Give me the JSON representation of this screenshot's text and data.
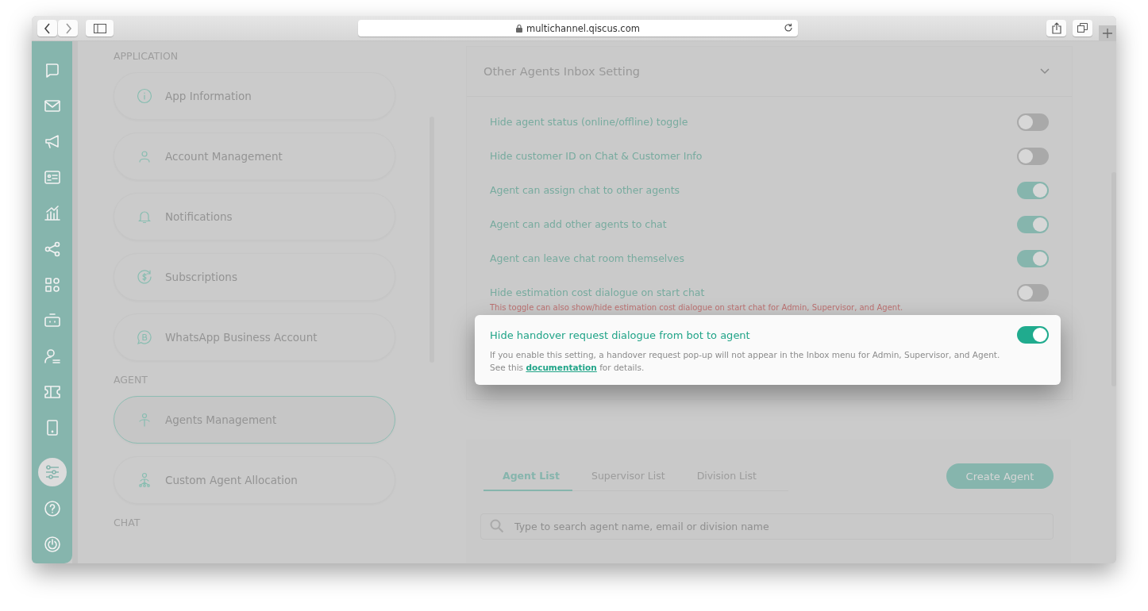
{
  "browser": {
    "url": "multichannel.qiscus.com"
  },
  "rail": [
    {
      "selected": false
    },
    {
      "selected": false
    },
    {
      "selected": false
    },
    {
      "selected": false
    },
    {
      "selected": false
    },
    {
      "selected": false
    },
    {
      "selected": false
    },
    {
      "selected": false
    },
    {
      "selected": false
    },
    {
      "selected": false
    },
    {
      "selected": false
    },
    {
      "selected": true
    },
    {
      "selected": false
    },
    {
      "selected": false
    }
  ],
  "settings_menu": [
    {
      "heading": "APPLICATION",
      "items": [
        {
          "label": "App Information",
          "selected": false
        },
        {
          "label": "Account Management",
          "selected": false
        },
        {
          "label": "Notifications",
          "selected": false
        },
        {
          "label": "Subscriptions",
          "selected": false
        },
        {
          "label": "WhatsApp Business Account",
          "selected": false
        }
      ]
    },
    {
      "heading": "AGENT",
      "items": [
        {
          "label": "Agents Management",
          "selected": true
        },
        {
          "label": "Custom Agent Allocation",
          "selected": false
        }
      ]
    },
    {
      "heading": "CHAT"
    }
  ],
  "inbox_setting": {
    "title": "Other Agents Inbox Setting",
    "expanded": true,
    "toggles": [
      {
        "label": "Hide agent status (online/offline) toggle",
        "on": false
      },
      {
        "label": "Hide customer ID on Chat & Customer Info",
        "on": false
      },
      {
        "label": "Agent can assign chat to other agents",
        "on": true
      },
      {
        "label": "Agent can add other agents to chat",
        "on": true
      },
      {
        "label": "Agent can leave chat room themselves",
        "on": true
      },
      {
        "label": "Hide estimation cost dialogue on start chat",
        "on": false,
        "note": "This toggle can also show/hide estimation cost dialogue on start chat for Admin, Supervisor, and Agent."
      }
    ],
    "highlighted": {
      "label": "Hide handover request dialogue from bot to agent",
      "on": true,
      "description": "If you enable this setting, a handover request pop-up will not appear in the Inbox menu for Admin, Supervisor, and Agent. See this",
      "link": "documentation",
      "description_end": "for details."
    }
  },
  "agents": {
    "tabs": [
      {
        "label": "Agent List",
        "selected": true
      },
      {
        "label": "Supervisor List",
        "selected": false
      },
      {
        "label": "Division List",
        "selected": false
      }
    ],
    "create_button": "Create Agent",
    "search": {
      "placeholder": "Type to search agent name, email or division name"
    }
  }
}
